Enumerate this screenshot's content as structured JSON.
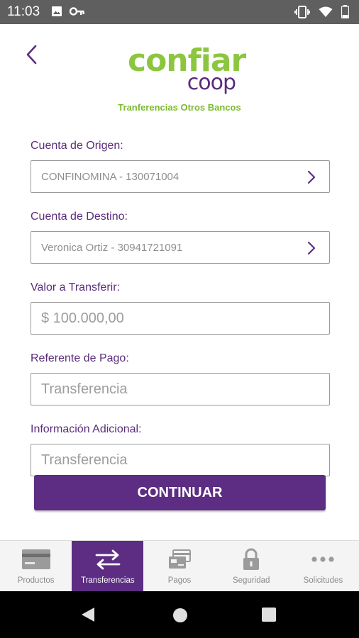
{
  "status_bar": {
    "time": "11:03",
    "icons": [
      "image-icon",
      "key-icon",
      "vibrate-icon",
      "wifi-icon",
      "battery-icon"
    ]
  },
  "header": {
    "logo_main": "confiar",
    "logo_sub": "coop",
    "title": "Tranferencias Otros Bancos"
  },
  "form": {
    "origin": {
      "label": "Cuenta de Origen:",
      "value": "CONFINOMINA - 130071004"
    },
    "destination": {
      "label": "Cuenta de Destino:",
      "value": "Veronica Ortiz - 30941721091"
    },
    "amount": {
      "label": "Valor a Transferir:",
      "placeholder": "$ 100.000,00"
    },
    "reference": {
      "label": "Referente de Pago:",
      "placeholder": "Transferencia"
    },
    "additional": {
      "label": "Información Adicional:",
      "placeholder": "Transferencia"
    },
    "continue_label": "CONTINUAR"
  },
  "bottom_nav": {
    "items": [
      {
        "label": "Productos",
        "icon": "card-icon",
        "active": false
      },
      {
        "label": "Transferencias",
        "icon": "transfer-arrows-icon",
        "active": true
      },
      {
        "label": "Pagos",
        "icon": "payments-icon",
        "active": false
      },
      {
        "label": "Seguridad",
        "icon": "lock-icon",
        "active": false
      },
      {
        "label": "Solicitudes",
        "icon": "more-dots-icon",
        "active": false
      }
    ]
  },
  "colors": {
    "brand_purple": "#5c2d82",
    "brand_green": "#8cc63f",
    "status_bar": "#5f5f5f"
  }
}
